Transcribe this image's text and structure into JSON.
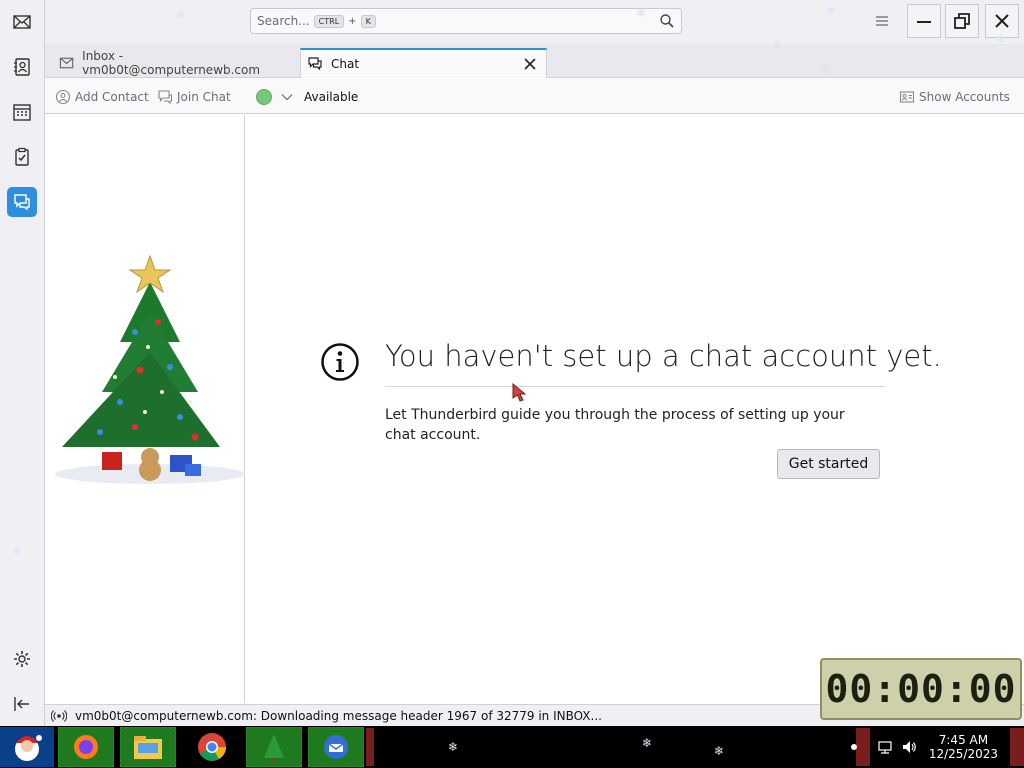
{
  "spaces": {
    "items": [
      {
        "icon": "mail-icon",
        "label": "Mail"
      },
      {
        "icon": "address-book-icon",
        "label": "Address Book"
      },
      {
        "icon": "calendar-icon",
        "label": "Calendar"
      },
      {
        "icon": "tasks-icon",
        "label": "Tasks"
      },
      {
        "icon": "chat-icon",
        "label": "Chat",
        "active": true
      }
    ],
    "bottom": [
      {
        "icon": "settings-icon"
      },
      {
        "icon": "collapse-icon"
      }
    ]
  },
  "titlebar": {
    "search_placeholder": "Search...",
    "shortcut_key1": "CTRL",
    "shortcut_plus": "+",
    "shortcut_key2": "K"
  },
  "tabs": [
    {
      "label": "Inbox - vm0b0t@computernewb.com",
      "icon": "inbox-icon",
      "active": false
    },
    {
      "label": "Chat",
      "icon": "chat-icon",
      "active": true
    }
  ],
  "toolbar": {
    "add_contact": "Add Contact",
    "join_chat": "Join Chat",
    "status": "Available",
    "status_color": "#77c77a",
    "show_accounts": "Show Accounts"
  },
  "notice": {
    "title": "You haven't set up a chat account yet.",
    "description": "Let Thunderbird guide you through the process of setting up your chat account.",
    "button": "Get started"
  },
  "statusbar": {
    "message": "vm0b0t@computernewb.com: Downloading message header 1967 of 32779 in INBOX..."
  },
  "timer": {
    "display": "00:00:00"
  },
  "taskbar": {
    "time": "7:45 AM",
    "date": "12/25/2023"
  },
  "colors": {
    "accent": "#2f8fde",
    "taskbar": "#000000"
  }
}
